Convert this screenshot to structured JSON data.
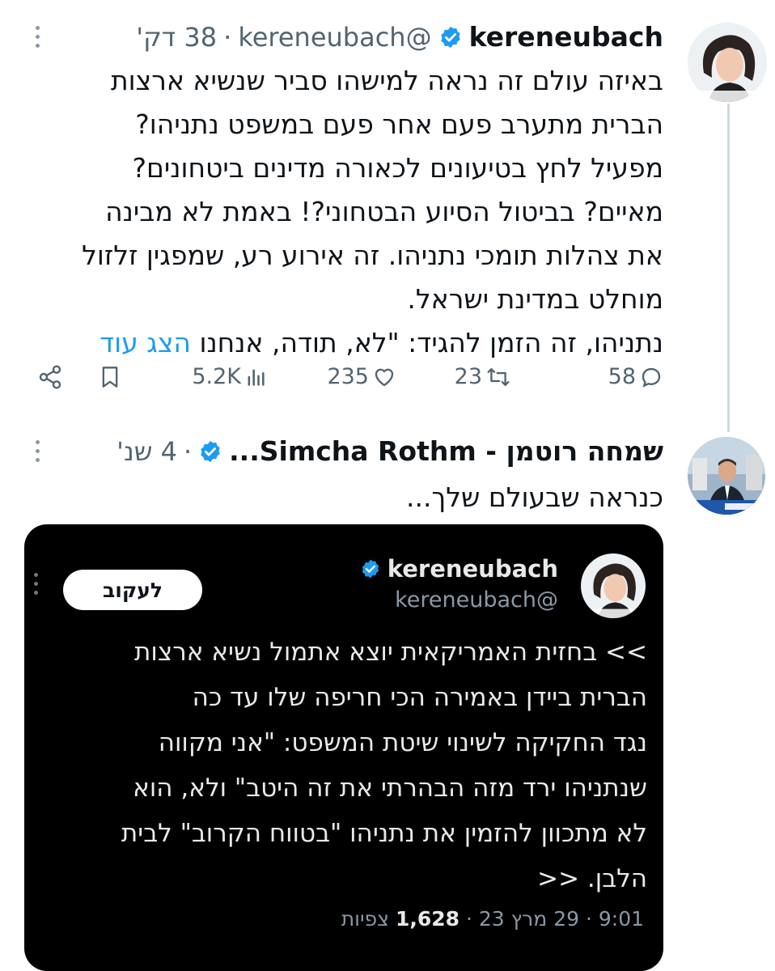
{
  "tweet1": {
    "display_name": "kereneubach",
    "handle": "@kereneubach",
    "separator": "·",
    "time": "38 דק'",
    "lines": [
      "באיזה עולם זה נראה למישהו סביר שנשיא ארצות",
      "הברית מתערב פעם אחר פעם במשפט נתניהו?",
      "מפעיל לחץ בטיעונים לכאורה מדינים ביטחונים?",
      "מאיים? בביטול הסיוע הבטחוני?! באמת לא מבינה",
      "את צהלות תומכי נתניהו. זה אירוע רע, שמפגין זלזול",
      "מוחלט במדינת ישראל."
    ],
    "last_line": "נתניהו, זה הזמן להגיד: \"לא, תודה, אנחנו",
    "show_more": "הצג עוד",
    "stats": {
      "replies": "58",
      "reposts": "23",
      "likes": "235",
      "views": "5.2K"
    }
  },
  "tweet2": {
    "display_name": "שמחה רוטמן - Simcha Rothm...",
    "separator": "·",
    "time": "4 שנ'",
    "text": "כנראה שבעולם שלך..."
  },
  "quoted": {
    "display_name": "kereneubach",
    "handle": "@kereneubach",
    "follow_label": "לעקוב",
    "lines": [
      ">> בחזית האמריקאית יוצא אתמול נשיא ארצות",
      "הברית ביידן באמירה הכי חריפה שלו עד כה",
      "נגד החקיקה לשינוי שיטת המשפט: \"אני מקווה",
      "שנתניהו ירד מזה הבהרתי את זה היטב\" ולא, הוא",
      "לא מתכוון להזמין את נתניהו \"בטווח הקרוב\" לבית",
      "הלבן. <<"
    ],
    "time": "9:01",
    "date": "29 מרץ 23",
    "separator": "·",
    "views_count": "1,628",
    "views_label": "צפיות"
  },
  "colors": {
    "verified_blue": "#1d9bf0",
    "text": "#0f1419",
    "secondary": "#536471",
    "card_bg": "#000000"
  }
}
